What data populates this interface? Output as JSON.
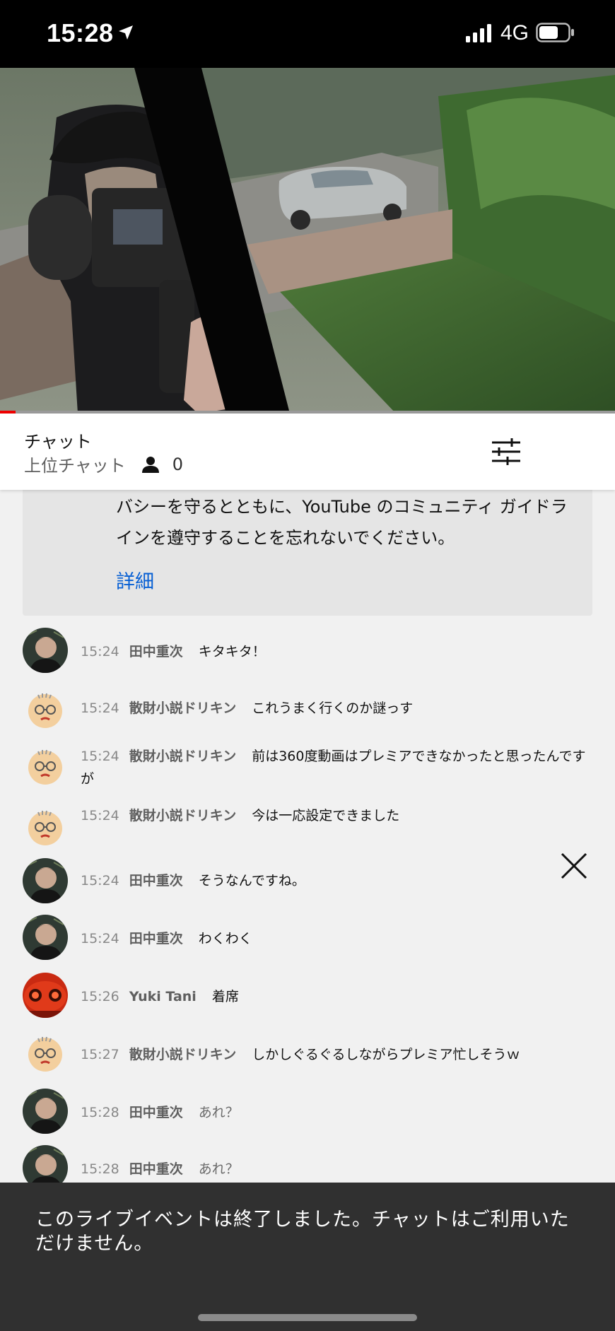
{
  "status_bar": {
    "time": "15:28",
    "network": "4G"
  },
  "video": {
    "progress_fraction": 0.025
  },
  "chat_header": {
    "title": "チャット",
    "mode": "上位チャット",
    "viewer_count": "0"
  },
  "notice": {
    "text": "バシーを守るとともに、YouTube のコミュニティ ガイドラインを遵守することを忘れないでください。",
    "link": "詳細"
  },
  "messages": [
    {
      "time": "15:24",
      "author": "田中重次",
      "text": "キタキタ！",
      "avatar": "tanaka"
    },
    {
      "time": "15:24",
      "author": "散財小説ドリキン",
      "text": "これうまく行くのか謎っす",
      "avatar": "drikin"
    },
    {
      "time": "15:24",
      "author": "散財小説ドリキン",
      "text": "前は360度動画はプレミアできなかったと思ったんですが",
      "avatar": "drikin"
    },
    {
      "time": "15:24",
      "author": "散財小説ドリキン",
      "text": "今は一応設定できました",
      "avatar": "drikin"
    },
    {
      "time": "15:24",
      "author": "田中重次",
      "text": "そうなんですね。",
      "avatar": "tanaka"
    },
    {
      "time": "15:24",
      "author": "田中重次",
      "text": "わくわく",
      "avatar": "tanaka"
    },
    {
      "time": "15:26",
      "author": "Yuki Tani",
      "text": "着席",
      "avatar": "yuki"
    },
    {
      "time": "15:27",
      "author": "散財小説ドリキン",
      "text": "しかしぐるぐるしながらプレミア忙しそうｗ",
      "avatar": "drikin"
    },
    {
      "time": "15:28",
      "author": "田中重次",
      "text": "あれ？",
      "avatar": "tanaka"
    },
    {
      "time": "15:28",
      "author": "田中重次",
      "text": "あれ？",
      "avatar": "tanaka"
    }
  ],
  "ended_banner": {
    "text": "このライブイベントは終了しました。チャットはご利用いただけません。"
  }
}
